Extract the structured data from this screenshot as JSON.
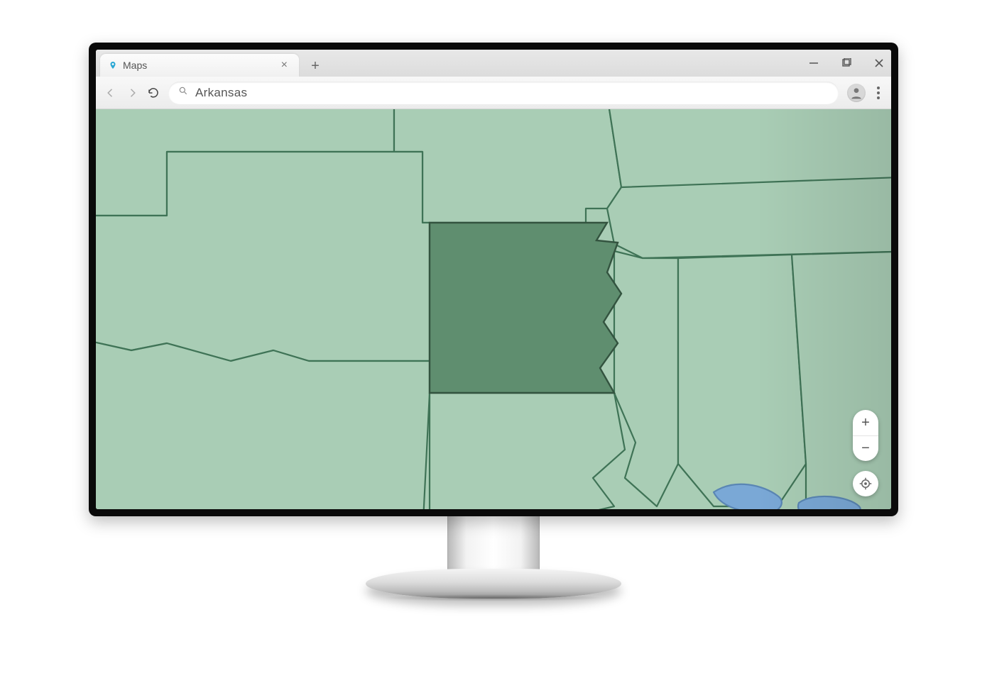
{
  "browser": {
    "tab": {
      "title": "Maps",
      "pin_icon": "map-pin-icon"
    },
    "omnibox": {
      "query": "Arkansas",
      "search_icon": "search-icon"
    },
    "window_controls": {
      "minimize": "−",
      "maximize": "❐",
      "close": "✕"
    }
  },
  "map": {
    "highlighted_region": "Arkansas",
    "colors": {
      "land": "#a9cdb5",
      "highlight": "#5f8e6f",
      "border": "#3f7356",
      "water": "#7aa8d6"
    },
    "controls": {
      "zoom_in": "+",
      "zoom_out": "−",
      "locate": "◎"
    }
  }
}
